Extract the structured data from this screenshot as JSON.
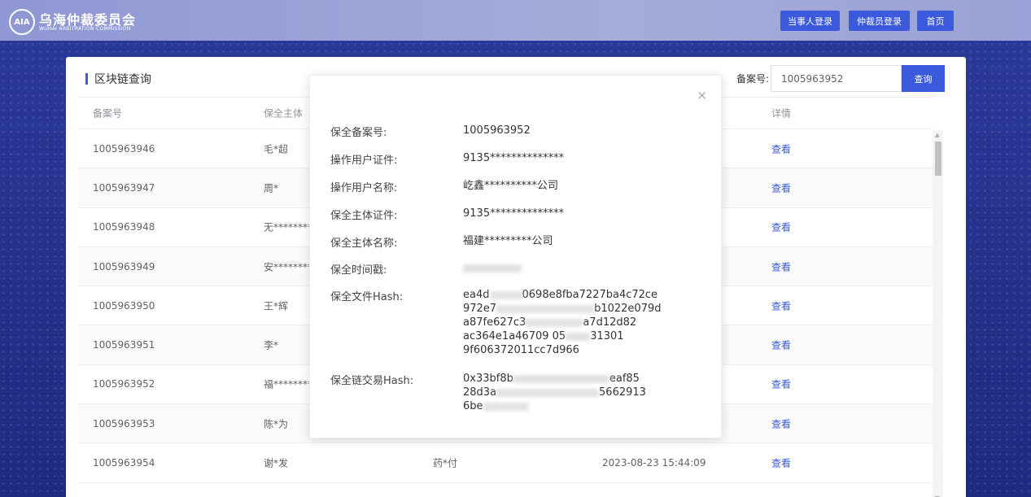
{
  "header": {
    "logo_mark": "AIA",
    "title": "乌海仲裁委员会",
    "subtitle": "WUHAI ARBITRATION COMMISSION",
    "buttons": [
      "当事人登录",
      "仲裁员登录",
      "首页"
    ]
  },
  "panel": {
    "title": "区块链查询",
    "search_label": "备案号:",
    "search_value": "1005963952",
    "search_button": "查询"
  },
  "table": {
    "columns": [
      "备案号",
      "保全主体",
      "",
      "",
      "详情"
    ],
    "rows": [
      {
        "id": "1005963946",
        "subject": "毛*超",
        "op": "",
        "time": "",
        "action": "查看"
      },
      {
        "id": "1005963947",
        "subject": "周*",
        "op": "",
        "time": "",
        "action": "查看"
      },
      {
        "id": "1005963948",
        "subject": "无*********",
        "op": "",
        "time": "",
        "action": "查看"
      },
      {
        "id": "1005963949",
        "subject": "安*********",
        "op": "",
        "time": "",
        "action": "查看"
      },
      {
        "id": "1005963950",
        "subject": "王*辉",
        "op": "",
        "time": "",
        "action": "查看"
      },
      {
        "id": "1005963951",
        "subject": "李*",
        "op": "",
        "time": "",
        "action": "查看"
      },
      {
        "id": "1005963952",
        "subject": "福*********",
        "op": "",
        "time": "",
        "action": "查看"
      },
      {
        "id": "1005963953",
        "subject": "陈*为",
        "op": "",
        "time": "",
        "action": "查看"
      },
      {
        "id": "1005963954",
        "subject": "谢*发",
        "op": "药*付",
        "time": "2023-08-23 15:44:09",
        "action": "查看"
      }
    ]
  },
  "modal": {
    "close": "×",
    "fields": [
      {
        "label": "保全备案号:",
        "value": "1005963952"
      },
      {
        "label": "操作用户证件:",
        "value": "9135**************"
      },
      {
        "label": "操作用户名称:",
        "value": "屹鑫**********公司"
      },
      {
        "label": "保全主体证件:",
        "value": "9135**************"
      },
      {
        "label": "保全主体名称:",
        "value": "福建*********公司"
      },
      {
        "label": "保全时间戳:",
        "value": ""
      },
      {
        "label": "保全文件Hash:",
        "lines": [
          "ea4d",
          "0698e8fba7227ba4c72ce",
          "972e7",
          "b1022e079d",
          "a87fe627c3",
          "a7d12d82",
          "ac364e1a46709 05",
          "31301",
          "9f606372011cc7d966"
        ]
      },
      {
        "label": "保全链交易Hash:",
        "lines": [
          "0x33bf8b",
          "eaf85",
          "28d3a",
          "5662913",
          "6be"
        ]
      }
    ]
  }
}
